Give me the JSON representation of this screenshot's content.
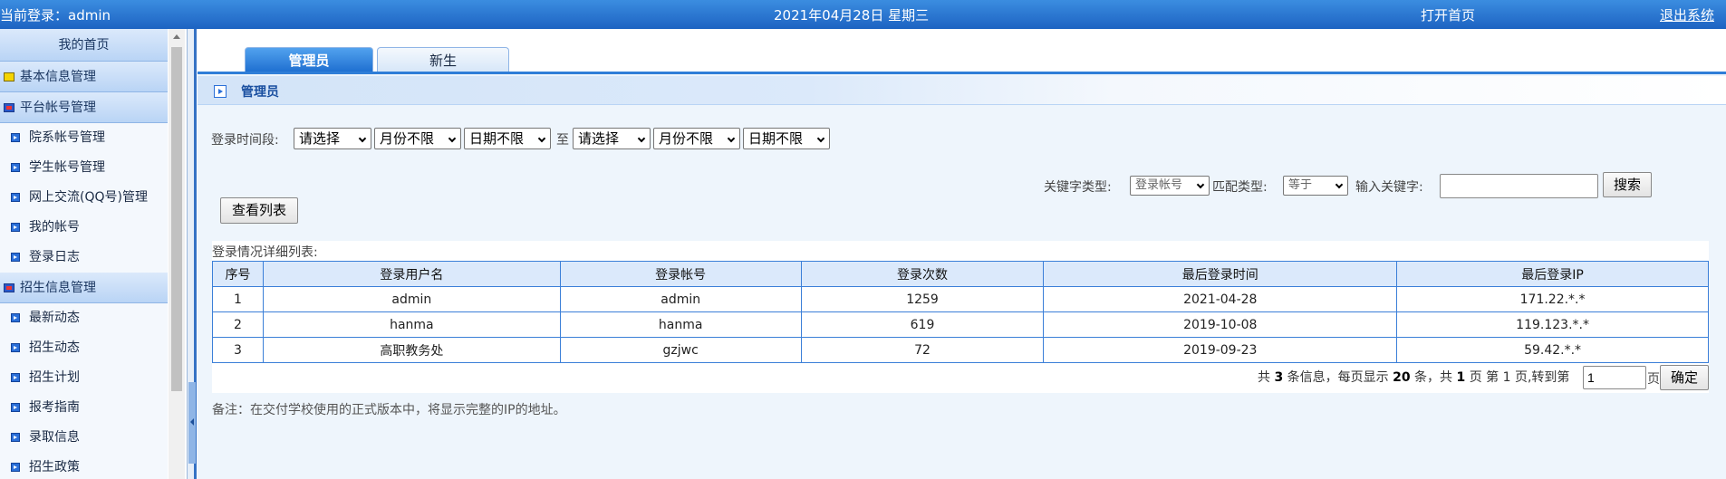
{
  "topbar": {
    "user_text": "当前登录：admin",
    "date_text": "2021年04月28日 星期三",
    "home_link": "打开首页",
    "exit_link": "退出系统"
  },
  "sidebar": {
    "home": "我的首页",
    "groups": [
      {
        "label": "基本信息管理",
        "icon": "yellow-square-icon"
      },
      {
        "label": "平台帐号管理",
        "icon": "window-icon",
        "items": [
          "院系帐号管理",
          "学生帐号管理",
          "网上交流(QQ号)管理",
          "我的帐号",
          "登录日志"
        ]
      },
      {
        "label": "招生信息管理",
        "icon": "window-icon",
        "items": [
          "最新动态",
          "招生动态",
          "招生计划",
          "报考指南",
          "录取信息",
          "招生政策"
        ]
      }
    ]
  },
  "tabs": {
    "active": "管理员",
    "inactive": "新生"
  },
  "panel": {
    "title": "管理员"
  },
  "filter": {
    "time_label": "登录时间段:",
    "to_label": "至",
    "from_year": "请选择",
    "from_month": "月份不限",
    "from_day": "日期不限",
    "to_year": "请选择",
    "to_month": "月份不限",
    "to_day": "日期不限",
    "keyword_type_label": "关键字类型:",
    "keyword_type_value": "登录帐号",
    "match_type_label": "匹配类型:",
    "match_type_value": "等于",
    "keyword_label": "输入关键字:",
    "keyword_value": "",
    "search_button": "搜索",
    "view_list_button": "查看列表"
  },
  "table": {
    "caption": "登录情况详细列表:",
    "columns": [
      "序号",
      "登录用户名",
      "登录帐号",
      "登录次数",
      "最后登录时间",
      "最后登录IP"
    ],
    "rows": [
      [
        "1",
        "admin",
        "admin",
        "1259",
        "2021-04-28",
        "171.22.*.*"
      ],
      [
        "2",
        "hanma",
        "hanma",
        "619",
        "2019-10-08",
        "119.123.*.*"
      ],
      [
        "3",
        "高职教务处",
        "gzjwc",
        "72",
        "2019-09-23",
        "59.42.*.*"
      ]
    ]
  },
  "pager": {
    "prefix": "共",
    "total": "3",
    "mid1": "条信息，每页显示",
    "per_page": "20",
    "mid2": "条，共",
    "pages": "1",
    "mid3": "页 第",
    "current": "1",
    "mid4": "页,转到第",
    "goto_value": "1",
    "suffix": "页",
    "confirm_button": "确定"
  },
  "note": "备注：在交付学校使用的正式版本中，将显示完整的IP的地址。",
  "colors": {
    "topbar": "#1d63c2",
    "tab_active": "#1d6ed0",
    "table_border": "#3b7fd8",
    "sidebar_header": "#b9d4f5"
  }
}
